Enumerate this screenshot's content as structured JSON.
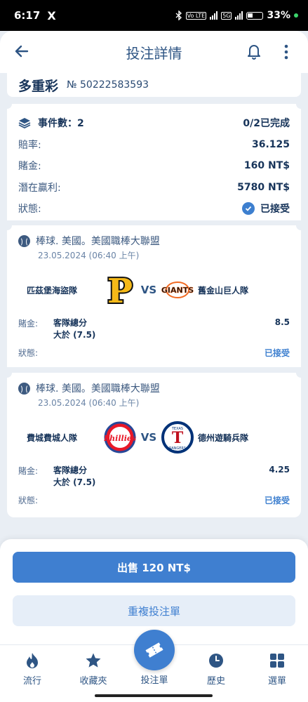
{
  "status_bar": {
    "time": "6:17",
    "x_icon": "X",
    "net1": "Vo LTE",
    "net2": "5G",
    "battery_pct": "33%"
  },
  "header": {
    "title": "投注詳情"
  },
  "ticket": {
    "type": "多重彩",
    "number": "№ 50222583593"
  },
  "summary": {
    "events_label": "事件數：2",
    "progress": "0/2已完成",
    "odds_label": "賠率:",
    "odds_value": "36.125",
    "stake_label": "賭金:",
    "stake_value": "160 NT$",
    "potential_label": "潛在贏利:",
    "potential_value": "5780 NT$",
    "status_label": "狀態:",
    "status_value": "已接受"
  },
  "events": [
    {
      "league": "棒球. 美國。美國職棒大聯盟",
      "date": "23.05.2024 (06:40 上午)",
      "home": "匹茲堡海盜隊",
      "away": "舊金山巨人隊",
      "vs": "VS",
      "stake_label": "賭金:",
      "pick_line1": "客隊總分",
      "pick_line2": "大於 (7.5)",
      "odd": "8.5",
      "status_label": "狀態:",
      "status_value": "已接受"
    },
    {
      "league": "棒球. 美國。美國職棒大聯盟",
      "date": "23.05.2024 (06:40 上午)",
      "home": "費城費城人隊",
      "away": "德州遊騎兵隊",
      "vs": "VS",
      "stake_label": "賭金:",
      "pick_line1": "客隊總分",
      "pick_line2": "大於 (7.5)",
      "odd": "4.25",
      "status_label": "狀態:",
      "status_value": "已接受"
    }
  ],
  "logos": {
    "pirates_letter": "P",
    "giants_text": "GIANTS",
    "phillies_text": "Phillies",
    "rangers_text": "TEXAS",
    "rangers_bottom": "RANGERS",
    "rangers_letter": "T"
  },
  "actions": {
    "sell": "出售 120 NT$",
    "repeat": "重複投注單"
  },
  "nav": {
    "hot": "流行",
    "favorites": "收藏夾",
    "betslip": "投注單",
    "history": "歷史",
    "menu": "選單"
  },
  "colors": {
    "accent": "#3f7fd0",
    "text": "#17345a",
    "background": "#e9eef4"
  }
}
